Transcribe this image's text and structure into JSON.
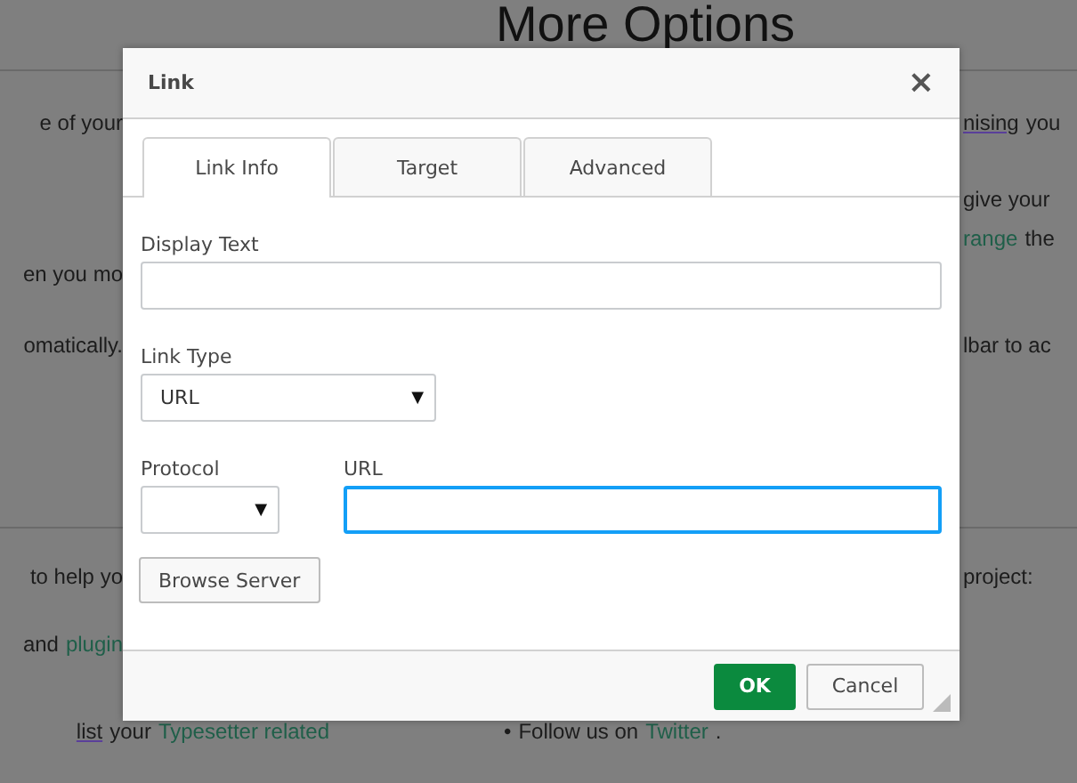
{
  "page": {
    "heading": "More Options",
    "rows": [
      {
        "kind": "rule"
      },
      {
        "kind": "text",
        "left": [
          {
            "kind": "text",
            "text": "e of your"
          }
        ],
        "right": [
          {
            "kind": "underlined",
            "text": "nising"
          },
          {
            "kind": "text",
            "text": "you"
          }
        ]
      },
      {
        "kind": "text",
        "right": [
          {
            "kind": "text",
            "text": "give your"
          }
        ]
      },
      {
        "kind": "text",
        "right": [
          {
            "kind": "link",
            "text": "range"
          },
          {
            "kind": "text",
            "text": "the"
          }
        ]
      },
      {
        "kind": "text",
        "left": [
          {
            "kind": "text",
            "text": "en you mo"
          }
        ]
      },
      {
        "kind": "text",
        "left": [
          {
            "kind": "text",
            "text": "omatically."
          }
        ],
        "right": [
          {
            "kind": "text",
            "text": "lbar to ac"
          }
        ]
      },
      {
        "kind": "rule"
      },
      {
        "kind": "text",
        "left": [
          {
            "kind": "text",
            "text": "to help yo"
          }
        ],
        "right": [
          {
            "kind": "text",
            "text": "project:"
          }
        ]
      },
      {
        "kind": "text",
        "left": [
          {
            "kind": "text",
            "text": "and"
          },
          {
            "kind": "link",
            "text": "plugin"
          }
        ]
      },
      {
        "kind": "wide",
        "left": [
          {
            "kind": "underlined",
            "text": "list"
          },
          {
            "kind": "text",
            "text": "your"
          },
          {
            "kind": "link",
            "text": "Typesetter related"
          }
        ],
        "right": [
          {
            "kind": "bullet",
            "text": "•"
          },
          {
            "kind": "text",
            "text": "Follow us on"
          },
          {
            "kind": "link",
            "text": "Twitter"
          },
          {
            "kind": "text",
            "text": "."
          }
        ]
      }
    ]
  },
  "dialog": {
    "title": "Link",
    "close": "×",
    "tabs": [
      {
        "label": "Link Info",
        "selected": true
      },
      {
        "label": "Target",
        "selected": false
      },
      {
        "label": "Advanced",
        "selected": false
      }
    ],
    "display_text": {
      "label": "Display Text"
    },
    "link_type": {
      "label": "Link Type",
      "value": "URL",
      "arrow": "▼"
    },
    "protocol": {
      "label": "Protocol",
      "arrow": "▼"
    },
    "url": {
      "label": "URL",
      "focused": true
    },
    "browse_button": "Browse Server",
    "buttons": [
      {
        "label": "OK",
        "kind": "primary"
      },
      {
        "label": "Cancel",
        "kind": "secondary"
      }
    ]
  }
}
